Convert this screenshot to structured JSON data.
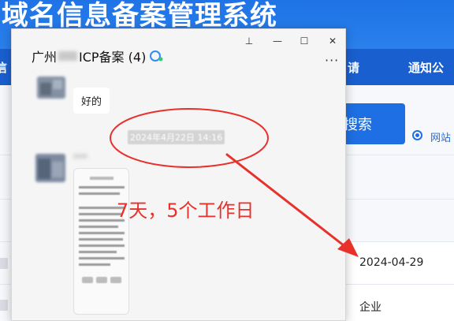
{
  "site": {
    "title": "域名信息备案管理系统",
    "nav_items": [
      "信",
      "请",
      "通知公"
    ],
    "search_label": "搜索",
    "radio_label": "网站"
  },
  "table": {
    "date_value": "2024-04-29",
    "type_value": "企业"
  },
  "chat_window": {
    "title_prefix": "广州",
    "title_suffix": "ICP备案 (4)",
    "controls": {
      "pin": "⊥",
      "minimize": "—",
      "maximize": "☐",
      "close": "✕"
    },
    "more": "···",
    "messages": [
      {
        "text": "好的"
      }
    ],
    "timestamp": "2024年4月22日 14:16"
  },
  "annotation": {
    "text": "7天，5个工作日",
    "color": "#e8312b"
  },
  "colors": {
    "banner": "#2a80ec",
    "nav": "#1a5fcf",
    "primary": "#1e6fe3"
  }
}
